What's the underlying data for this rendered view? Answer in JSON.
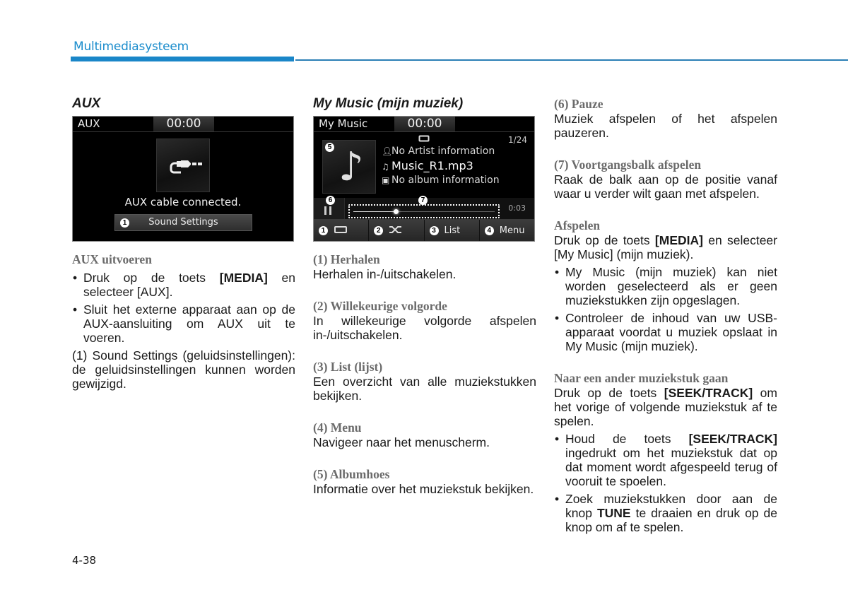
{
  "header": {
    "section_title": "Multimediasysteem",
    "accent_color": "#1a86c8"
  },
  "aux": {
    "heading": "AUX",
    "screen": {
      "title": "AUX",
      "clock": "00:00",
      "icon": "aux-cable-icon",
      "message": "AUX cable connected.",
      "button_callout": "1",
      "button_label": "Sound Settings"
    },
    "subheading": "AUX uitvoeren",
    "bullets": [
      {
        "pre": "Druk op de toets ",
        "bold": "[MEDIA]",
        "post": " en selecteer [AUX]."
      },
      {
        "text": "Sluit het externe apparaat aan op de AUX-aansluiting om AUX uit te voeren."
      }
    ],
    "numbered_note": "(1) Sound Settings (geluidsinstellingen): de geluidsinstellingen kunnen worden gewijzigd."
  },
  "my_music": {
    "heading": "My Music (mijn muziek)",
    "screen": {
      "title": "My Music",
      "clock": "00:00",
      "track_count": "1/24",
      "repeat_icon": "repeat-icon",
      "artist": "No Artist information",
      "track": "Music_R1.mp3",
      "album": "No album information",
      "elapsed": "0:03",
      "progress_fraction": 0.3,
      "callouts": {
        "album": "5",
        "pause": "6",
        "progress": "7"
      },
      "buttons": [
        {
          "callout": "1",
          "icon": "repeat-icon",
          "label": ""
        },
        {
          "callout": "2",
          "icon": "shuffle-icon",
          "label": ""
        },
        {
          "callout": "3",
          "icon": "",
          "label": "List"
        },
        {
          "callout": "4",
          "icon": "",
          "label": "Menu"
        }
      ]
    },
    "items": [
      {
        "title": "(1) Herhalen",
        "text": "Herhalen in-/uitschakelen."
      },
      {
        "title": "(2) Willekeurige volgorde",
        "text": "In willekeurige volgorde afspelen in-/uitschakelen."
      },
      {
        "title": "(3) List (lijst)",
        "text": "Een overzicht van alle muziekstukken bekijken."
      },
      {
        "title": "(4) Menu",
        "text": "Navigeer naar het menuscherm."
      },
      {
        "title": "(5) Albumhoes",
        "text": "Informatie over het muziekstuk bekijken."
      }
    ]
  },
  "right_column": {
    "items": [
      {
        "title": "(6) Pauze",
        "text": "Muziek afspelen of het afspelen pauzeren."
      },
      {
        "title": "(7) Voortgangsbalk afspelen",
        "text": "Raak de balk aan op de positie vanaf waar u verder wilt gaan met afspelen."
      }
    ],
    "afspelen": {
      "title": "Afspelen",
      "intro_pre": "Druk op de toets ",
      "intro_bold": "[MEDIA]",
      "intro_post": " en selecteer [My Music] (mijn muziek).",
      "bullets": [
        "My Music (mijn muziek) kan niet worden geselecteerd als er geen muziekstukken zijn opgeslagen.",
        "Controleer de inhoud van uw USB-apparaat voordat u muziek opslaat in My Music (mijn muziek)."
      ]
    },
    "naar": {
      "title": "Naar een ander muziekstuk gaan",
      "intro_pre": "Druk op de toets ",
      "intro_bold": "[SEEK/TRACK]",
      "intro_post": " om het vorige of volgende muziekstuk af te spelen.",
      "bullet1_pre": "Houd de toets ",
      "bullet1_bold": "[SEEK/TRACK]",
      "bullet1_post": " ingedrukt om het muziekstuk dat op dat moment wordt afgespeeld terug of vooruit te spoelen.",
      "bullet2_pre": "Zoek muziekstukken door aan de knop ",
      "bullet2_bold": "TUNE",
      "bullet2_post": " te draaien en druk op de knop om af te spelen."
    }
  },
  "footer": {
    "page_number": "4-38"
  }
}
